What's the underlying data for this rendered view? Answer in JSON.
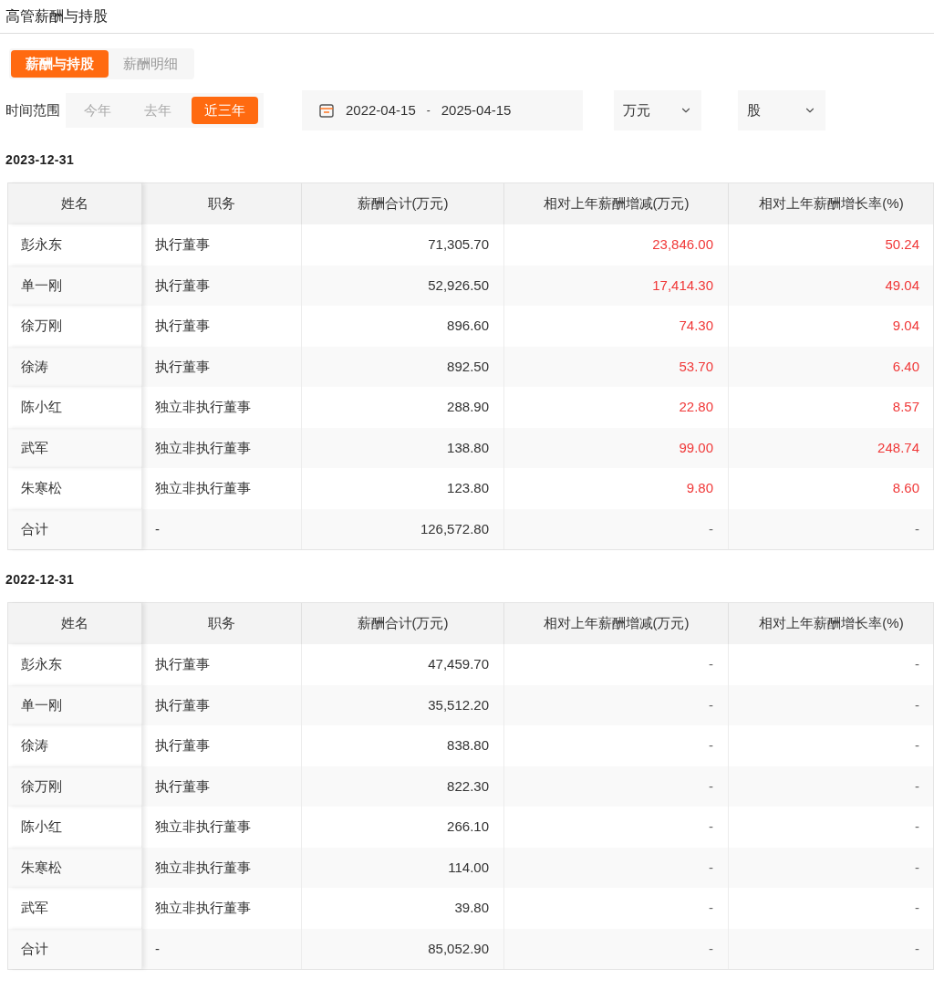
{
  "title": "高管薪酬与持股",
  "tabs": [
    {
      "label": "薪酬与持股",
      "selected": true
    },
    {
      "label": "薪酬明细",
      "selected": false
    }
  ],
  "time_range": {
    "label": "时间范围",
    "options": [
      {
        "label": "今年",
        "selected": false
      },
      {
        "label": "去年",
        "selected": false
      },
      {
        "label": "近三年",
        "selected": true
      }
    ]
  },
  "date_range": {
    "start": "2022-04-15",
    "separator": "-",
    "end": "2025-04-15"
  },
  "unit_selects": [
    "万元",
    "股"
  ],
  "tables": [
    {
      "date": "2023-12-31",
      "columns": [
        "姓名",
        "职务",
        "薪酬合计(万元)",
        "相对上年薪酬增减(万元)",
        "相对上年薪酬增长率(%)"
      ],
      "rows": [
        {
          "cells": [
            "彭永东",
            "执行董事",
            "71,305.70",
            "23,846.00",
            "50.24"
          ],
          "rising": true
        },
        {
          "cells": [
            "单一刚",
            "执行董事",
            "52,926.50",
            "17,414.30",
            "49.04"
          ],
          "rising": true
        },
        {
          "cells": [
            "徐万刚",
            "执行董事",
            "896.60",
            "74.30",
            "9.04"
          ],
          "rising": true
        },
        {
          "cells": [
            "徐涛",
            "执行董事",
            "892.50",
            "53.70",
            "6.40"
          ],
          "rising": true
        },
        {
          "cells": [
            "陈小红",
            "独立非执行董事",
            "288.90",
            "22.80",
            "8.57"
          ],
          "rising": true
        },
        {
          "cells": [
            "武军",
            "独立非执行董事",
            "138.80",
            "99.00",
            "248.74"
          ],
          "rising": true
        },
        {
          "cells": [
            "朱寒松",
            "独立非执行董事",
            "123.80",
            "9.80",
            "8.60"
          ],
          "rising": true
        },
        {
          "cells": [
            "合计",
            "-",
            "126,572.80",
            "-",
            "-"
          ],
          "rising": false
        }
      ]
    },
    {
      "date": "2022-12-31",
      "columns": [
        "姓名",
        "职务",
        "薪酬合计(万元)",
        "相对上年薪酬增减(万元)",
        "相对上年薪酬增长率(%)"
      ],
      "rows": [
        {
          "cells": [
            "彭永东",
            "执行董事",
            "47,459.70",
            "-",
            "-"
          ],
          "rising": false
        },
        {
          "cells": [
            "单一刚",
            "执行董事",
            "35,512.20",
            "-",
            "-"
          ],
          "rising": false
        },
        {
          "cells": [
            "徐涛",
            "执行董事",
            "838.80",
            "-",
            "-"
          ],
          "rising": false
        },
        {
          "cells": [
            "徐万刚",
            "执行董事",
            "822.30",
            "-",
            "-"
          ],
          "rising": false
        },
        {
          "cells": [
            "陈小红",
            "独立非执行董事",
            "266.10",
            "-",
            "-"
          ],
          "rising": false
        },
        {
          "cells": [
            "朱寒松",
            "独立非执行董事",
            "114.00",
            "-",
            "-"
          ],
          "rising": false
        },
        {
          "cells": [
            "武军",
            "独立非执行董事",
            "39.80",
            "-",
            "-"
          ],
          "rising": false
        },
        {
          "cells": [
            "合计",
            "-",
            "85,052.90",
            "-",
            "-"
          ],
          "rising": false
        }
      ]
    }
  ]
}
